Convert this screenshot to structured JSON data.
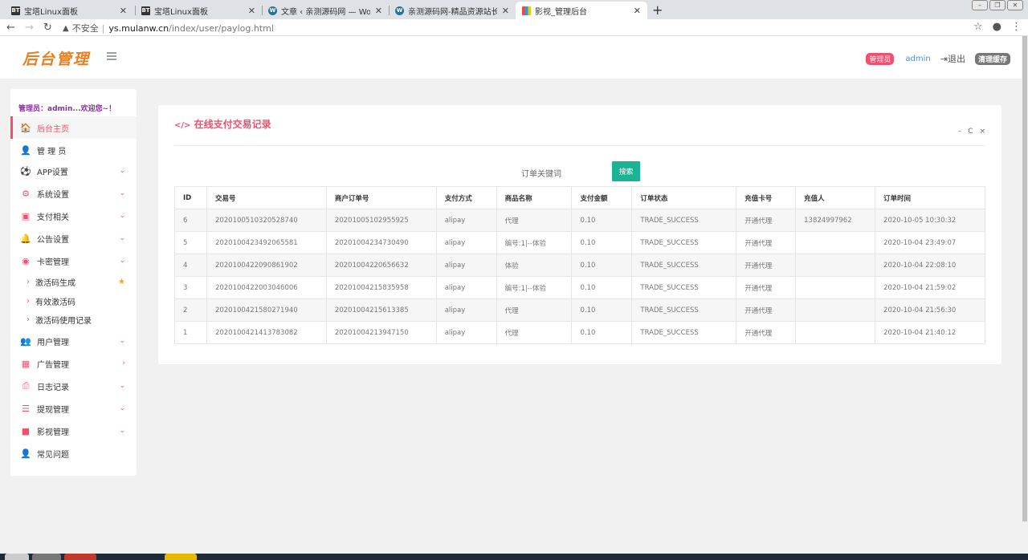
{
  "browser": {
    "tabs": [
      {
        "title": "宝塔Linux面板",
        "favicon": "BT"
      },
      {
        "title": "宝塔Linux面板",
        "favicon": "BT"
      },
      {
        "title": "文章 ‹ 亲测源码网 — WordPress",
        "favicon": "W"
      },
      {
        "title": "亲测源码网-精品资源站长亲测",
        "favicon": "W"
      },
      {
        "title": "影视_管理后台",
        "favicon": ""
      }
    ],
    "new_tab": "+",
    "url_insecure": "不安全",
    "url_host": "ys.mulanw.cn",
    "url_path": "/index/user/paylog.html"
  },
  "header": {
    "logo": "后台管理",
    "role_badge": "管理员",
    "username": "admin",
    "logout": "退出",
    "clear_cache": "清理缓存"
  },
  "sidebar": {
    "welcome": "管理员：admin...欢迎您~！",
    "items": [
      {
        "label": "后台主页",
        "icon": "home-icon",
        "glyph": "🏠",
        "arrow": ""
      },
      {
        "label": "管 理 员",
        "icon": "user-icon",
        "glyph": "👤",
        "arrow": ""
      },
      {
        "label": "APP设置",
        "icon": "ball-icon",
        "glyph": "⚽",
        "arrow": "⌄"
      },
      {
        "label": "系统设置",
        "icon": "gears-icon",
        "glyph": "⚙",
        "arrow": "⌄"
      },
      {
        "label": "支付相关",
        "icon": "money-icon",
        "glyph": "▣",
        "arrow": "⌄"
      },
      {
        "label": "公告设置",
        "icon": "bell-icon",
        "glyph": "🔔",
        "arrow": "⌄"
      },
      {
        "label": "卡密管理",
        "icon": "globe-icon",
        "glyph": "◉",
        "arrow": "⌄"
      },
      {
        "label": "用户管理",
        "icon": "users-icon",
        "glyph": "👥",
        "arrow": "⌄"
      },
      {
        "label": "广告管理",
        "icon": "table-icon",
        "glyph": "▦",
        "arrow": "›"
      },
      {
        "label": "日志记录",
        "icon": "print-icon",
        "glyph": "⎙",
        "arrow": "⌄"
      },
      {
        "label": "提现管理",
        "icon": "list-icon",
        "glyph": "☰",
        "arrow": "⌄"
      },
      {
        "label": "影视管理",
        "icon": "video-icon",
        "glyph": "■",
        "arrow": "⌄"
      },
      {
        "label": "常见问题",
        "icon": "user-icon",
        "glyph": "👤",
        "arrow": ""
      }
    ],
    "subitems": [
      {
        "label": "激活码生成"
      },
      {
        "label": "有效激活码"
      },
      {
        "label": "激活码使用记录"
      }
    ]
  },
  "panel": {
    "title": "在线支付交易记录",
    "title_icon": "</>",
    "search_label": "订单关键词",
    "search_button": "搜索",
    "tool_minimize": "–",
    "tool_refresh": "C",
    "tool_close": "×"
  },
  "table": {
    "columns": [
      "ID",
      "交易号",
      "商户订单号",
      "支付方式",
      "商品名称",
      "支付金额",
      "订单状态",
      "充值卡号",
      "充值人",
      "订单时间"
    ],
    "rows": [
      [
        "6",
        "2020100510320528740",
        "20201005102955925",
        "alipay",
        "代理",
        "0.10",
        "TRADE_SUCCESS",
        "开通代理",
        "13824997962",
        "2020-10-05 10:30:32"
      ],
      [
        "5",
        "2020100423492065581",
        "20201004234730490",
        "alipay",
        "编号:1|--体验",
        "0.10",
        "TRADE_SUCCESS",
        "开通代理",
        "",
        "2020-10-04 23:49:07"
      ],
      [
        "4",
        "2020100422090861902",
        "20201004220656632",
        "alipay",
        "体验",
        "0.10",
        "TRADE_SUCCESS",
        "开通代理",
        "",
        "2020-10-04 22:08:10"
      ],
      [
        "3",
        "2020100422003046006",
        "20201004215835958",
        "alipay",
        "编号:1|--体验",
        "0.10",
        "TRADE_SUCCESS",
        "开通代理",
        "",
        "2020-10-04 21:59:02"
      ],
      [
        "2",
        "2020100421580271940",
        "20201004215613385",
        "alipay",
        "代理",
        "0.10",
        "TRADE_SUCCESS",
        "开通代理",
        "",
        "2020-10-04 21:56:30"
      ],
      [
        "1",
        "2020100421413783082",
        "20201004213947150",
        "alipay",
        "代理",
        "0.10",
        "TRADE_SUCCESS",
        "开通代理",
        "",
        "2020-10-04 21:40:12"
      ]
    ]
  },
  "colors": {
    "accent": "#f0506e",
    "logo": "#f07c1a",
    "search_button": "#1ab394"
  }
}
